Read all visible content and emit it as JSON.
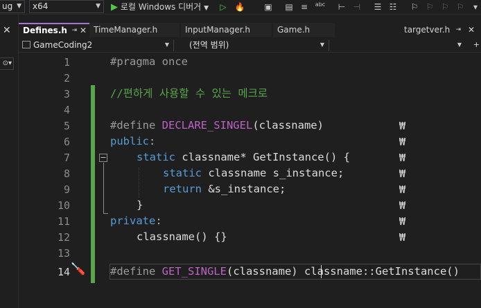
{
  "toolbar": {
    "config_fragment": "ug",
    "platform": "x64",
    "debugger_label": "로컬 Windows 디버거",
    "spell_label": "abc"
  },
  "tabs": [
    {
      "label": "Defines.h",
      "active": true
    },
    {
      "label": "TimeManager.h"
    },
    {
      "label": "InputManager.h"
    },
    {
      "label": "Game.h"
    }
  ],
  "right_tab": {
    "label": "targetver.h"
  },
  "navbar": {
    "project": "GameCoding2",
    "scope": "(전역 범위)"
  },
  "editor": {
    "line_numbers": [
      "1",
      "2",
      "3",
      "4",
      "5",
      "6",
      "7",
      "8",
      "9",
      "10",
      "11",
      "12",
      "13",
      "14"
    ],
    "current_line": "14",
    "continuation": "\\",
    "lines": {
      "l1": {
        "pp": "#pragma once"
      },
      "l3": {
        "comment": "//편하게 사용할 수 있는 메크로"
      },
      "l5": {
        "pp": "#define ",
        "mac": "DECLARE_SINGEL",
        "rest": "(classname)"
      },
      "l6": {
        "kw": "public",
        "pu": ":"
      },
      "l7": {
        "kw": "static",
        "rest": " classname* ",
        "fn": "GetInstance",
        "end": "() {"
      },
      "l8": {
        "kw": "static",
        "rest": " classname s_instance;"
      },
      "l9": {
        "kw": "return",
        "rest": " &s_instance;"
      },
      "l10": {
        "rest": "}"
      },
      "l11": {
        "kw": "private",
        "pu": ":"
      },
      "l12": {
        "fn": "classname",
        "rest": "() {}"
      },
      "l14": {
        "pp": "#define ",
        "mac": "GET_SINGLE",
        "rest": "(classname) classname::",
        "fn": "GetInstance",
        "end": "()"
      }
    }
  },
  "colors": {
    "background": "#1f1f1f",
    "keyword": "#569cd6",
    "macro": "#bd63c5",
    "comment": "#57a64a",
    "active_tab_accent": "#a774d6"
  }
}
